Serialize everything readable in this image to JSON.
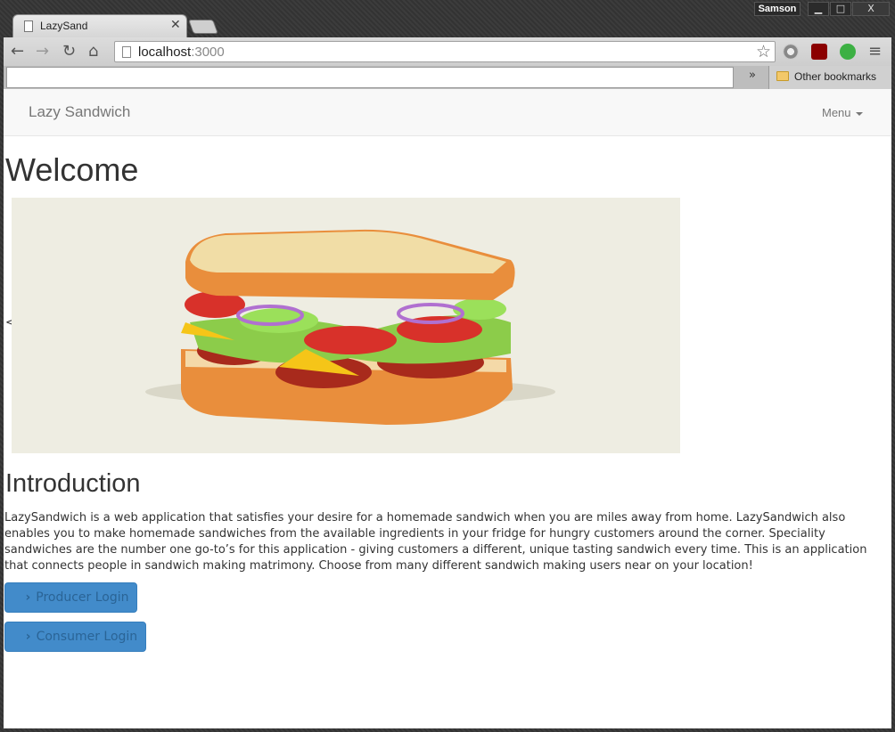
{
  "window": {
    "user": "Samson",
    "minimize": "▁",
    "maximize": "□",
    "close": "X"
  },
  "tab": {
    "title": "LazySand",
    "close": "✕"
  },
  "toolbar": {
    "back": "←",
    "forward": "→",
    "reload": "↻",
    "home": "⌂",
    "url_host": "localhost",
    "url_port": ":3000",
    "bookmark_star": "☆",
    "menu": "≡"
  },
  "bookmarks": {
    "overflow": "»",
    "other_label": "Other bookmarks"
  },
  "navbar": {
    "brand": "Lazy Sandwich",
    "menu_label": "Menu"
  },
  "main": {
    "heading": "Welcome",
    "carousel_prev": "<",
    "intro_heading": "Introduction",
    "intro_text": "LazySandwich is a web application that satisfies your desire for a homemade sandwich when you are miles away from home. LazySandwich also enables you to make homemade sandwiches from the available ingredients in your fridge for hungry customers around the corner. Speciality sandwiches are the number one go-to’s for this application - giving customers a different, unique tasting sandwich every time. This is an application that connects people in sandwich making matrimony. Choose from many different sandwich making users near on your location!",
    "producer_login": "Producer Login",
    "consumer_login": "Consumer Login"
  },
  "colors": {
    "primary_button": "#428bca",
    "navbar_bg": "#f8f8f8",
    "hero_bg": "#eeede2"
  }
}
